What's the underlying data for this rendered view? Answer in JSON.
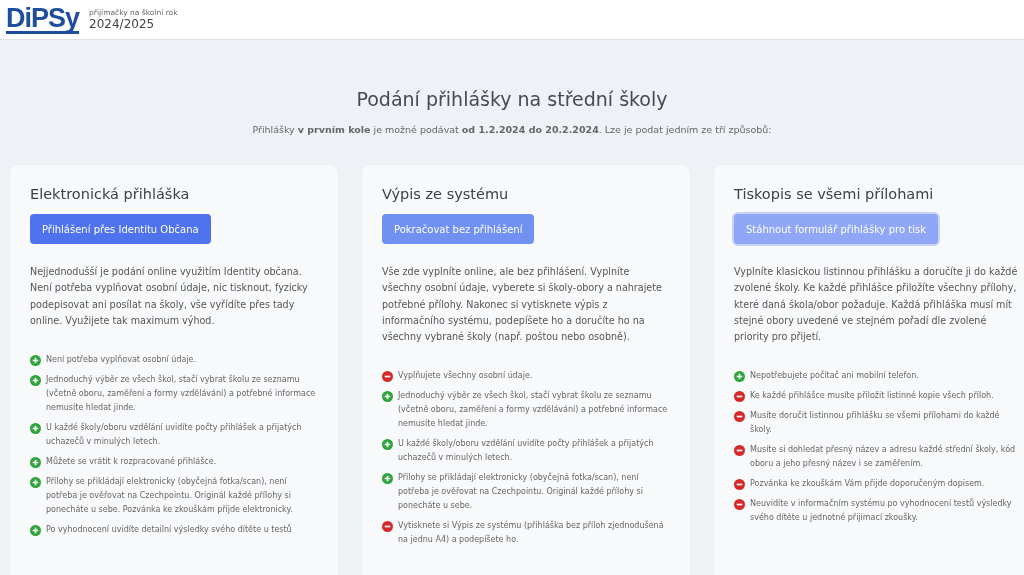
{
  "header": {
    "logo": "DiPSy",
    "subtitle": "přijímačky na školní rok",
    "year": "2024/2025"
  },
  "title": "Podání přihlášky na střední školy",
  "intro": "Přihlášky **v prvním kole** je možné podávat **od 1.2.2024 do 20.2.2024**. Lze je podat jedním ze tří způsobů:",
  "cards": [
    {
      "title": "Elektronická přihláška",
      "button": {
        "label": "Přihlášení přes Identitu Občana",
        "focused": false
      },
      "description": "Nejjednodušší je podání online využitím Identity občana. Není potřeba vyplňovat osobní údaje, nic tisknout, fyzicky podepisovat ani posílat na školy, vše vyřídíte přes tady online. Využijete tak maximum výhod.",
      "items": [
        {
          "kind": "pro",
          "text": "Není potřeba vyplňovat osobní údaje."
        },
        {
          "kind": "pro",
          "text": "Jednoduchý výběr ze všech škol, stačí vybrat školu ze seznamu (včetně oboru, zaměření a formy vzdělávání) a potřebné informace nemusíte hledat jinde."
        },
        {
          "kind": "pro",
          "text": "U každé školy/oboru vzdělání uvidíte počty přihlášek a přijatých uchazečů v minulých letech."
        },
        {
          "kind": "pro",
          "text": "Můžete se vrátit k rozpracované přihlášce."
        },
        {
          "kind": "pro",
          "text": "Přílohy se přikládají elektronicky (obyčejná fotka/scan), není potřeba je ověřovat na Czechpointu. Originál každé přílohy si ponecháte u sebe. Pozvánka ke zkouškám přijde elektronicky."
        },
        {
          "kind": "pro",
          "text": "Po vyhodnocení uvidíte detailní výsledky svého dítěte u testů"
        }
      ]
    },
    {
      "title": "Výpis ze systému",
      "button": {
        "label": "Pokračovat bez přihlášení",
        "focused": false
      },
      "description": "Vše zde vyplníte online, ale bez přihlášení. Vyplníte všechny osobní údaje, vyberete si školy-obory a nahrajete potřebné přílohy. Nakonec si vytisknete výpis z informačního systému, podepíšete ho a doručíte ho na všechny vybrané školy (např. poštou nebo osobně).",
      "items": [
        {
          "kind": "con",
          "text": "Vyplňujete všechny osobní údaje."
        },
        {
          "kind": "pro",
          "text": "Jednoduchý výběr ze všech škol, stačí vybrat školu ze seznamu (včetně oboru, zaměření a formy vzdělávání) a potřebné informace nemusíte hledat jinde."
        },
        {
          "kind": "pro",
          "text": "U každé školy/oboru vzdělání uvidíte počty přihlášek a přijatých uchazečů v minulých letech."
        },
        {
          "kind": "pro",
          "text": "Přílohy se přikládají elektronicky (obyčejná fotka/scan), není potřeba je ověřovat na Czechpointu. Originál každé přílohy si ponecháte u sebe."
        },
        {
          "kind": "con",
          "text": "Vytisknete si Výpis ze systému (přihláška bez příloh zjednodušená na jednu A4) a podepíšete ho."
        }
      ]
    },
    {
      "title": "Tiskopis se všemi přílohami",
      "button": {
        "label": "Stáhnout formulář přihlášky pro tisk",
        "focused": true
      },
      "description": "Vyplníte klasickou listinnou přihlášku a doručíte ji do každé zvolené školy. Ke každé přihlášce přiložíte všechny přílohy, které daná škola/obor požaduje. Každá přihláška musí mít stejné obory uvedené ve stejném pořadí dle zvolené priority pro přijetí.",
      "items": [
        {
          "kind": "pro",
          "text": "Nepotřebujete počítač ani mobilní telefon."
        },
        {
          "kind": "con",
          "text": "Ke každé přihlášce musíte přiložit listinné kopie všech příloh."
        },
        {
          "kind": "con",
          "text": "Musíte doručit listinnou přihlášku se všemi přílohami do každé školy."
        },
        {
          "kind": "con",
          "text": "Musíte si dohledat přesný název a adresu každé střední školy, kód oboru a jeho přesný název i se zaměřením."
        },
        {
          "kind": "con",
          "text": "Pozvánka ke zkouškám Vám přijde doporučeným dopisem."
        },
        {
          "kind": "con",
          "text": "Neuvidíte v informačním systému po vyhodnocení testů výsledky svého dítěte u jednotné přijímací zkoušky."
        }
      ]
    }
  ]
}
